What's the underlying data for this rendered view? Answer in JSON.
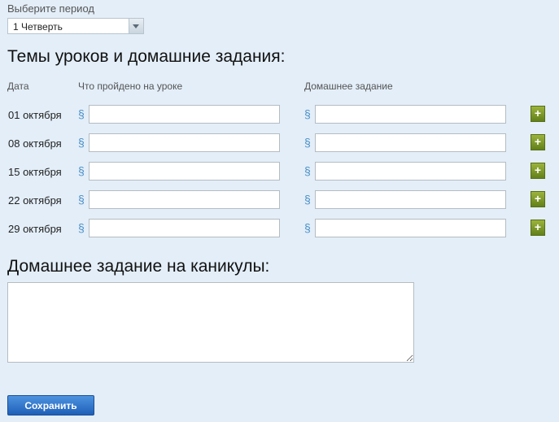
{
  "period": {
    "label": "Выберите период",
    "selected": "1 Четверть"
  },
  "lessons": {
    "title": "Темы уроков и домашние задания:",
    "headers": {
      "date": "Дата",
      "topic": "Что пройдено на уроке",
      "homework": "Домашнее задание"
    },
    "section_symbol": "§",
    "add_symbol": "+",
    "rows": [
      {
        "date": "01 октября",
        "topic": "",
        "homework": ""
      },
      {
        "date": "08 октября",
        "topic": "",
        "homework": ""
      },
      {
        "date": "15 октября",
        "topic": "",
        "homework": ""
      },
      {
        "date": "22 октября",
        "topic": "",
        "homework": ""
      },
      {
        "date": "29 октября",
        "topic": "",
        "homework": ""
      }
    ]
  },
  "vacation": {
    "title": "Домашнее задание на каникулы:",
    "value": ""
  },
  "save_label": "Сохранить",
  "colors": {
    "background": "#e3eef8",
    "accent_blue": "#1f5fb8",
    "add_button_green": "#62801a",
    "section_symbol": "#4a8fc7"
  },
  "icons": {
    "dropdown": "chevron-down-icon",
    "add": "plus-icon",
    "section": "section-sign-icon"
  }
}
